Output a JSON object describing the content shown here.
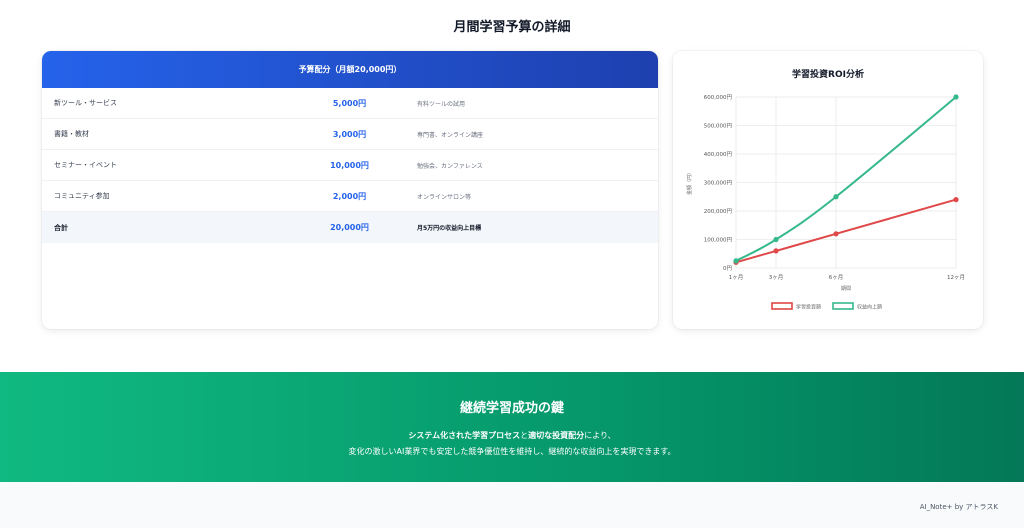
{
  "page": {
    "title": "月間学習予算の詳細"
  },
  "budget": {
    "header": "予算配分（月額20,000円）",
    "rows": [
      {
        "name": "新ツール・サービス",
        "amount": "5,000円",
        "note": "有料ツールの試用"
      },
      {
        "name": "書籍・教材",
        "amount": "3,000円",
        "note": "専門書、オンライン講座"
      },
      {
        "name": "セミナー・イベント",
        "amount": "10,000円",
        "note": "勉強会、カンファレンス"
      },
      {
        "name": "コミュニティ参加",
        "amount": "2,000円",
        "note": "オンラインサロン等"
      }
    ],
    "total": {
      "name": "合計",
      "amount": "20,000円",
      "note": "月5万円の収益向上目標"
    }
  },
  "roi_chart": {
    "title": "学習投資ROI分析"
  },
  "chart_data": {
    "type": "line",
    "categories": [
      "1ヶ月",
      "3ヶ月",
      "6ヶ月",
      "12ヶ月"
    ],
    "x_positions_months": [
      1,
      3,
      6,
      12
    ],
    "series": [
      {
        "name": "学習投資額",
        "color": "#e04848",
        "values": [
          20000,
          60000,
          120000,
          240000
        ]
      },
      {
        "name": "収益向上額",
        "color": "#35b98a",
        "values": [
          25000,
          100000,
          250000,
          600000
        ]
      }
    ],
    "xlabel": "期間",
    "ylabel": "金額（円）",
    "ylim": [
      0,
      600000
    ],
    "yticks": [
      "0円",
      "100,000円",
      "200,000円",
      "300,000円",
      "400,000円",
      "500,000円",
      "600,000円"
    ],
    "grid": true,
    "legend": "bottom"
  },
  "banner": {
    "title": "継続学習成功の鍵",
    "line1_strong1": "システム化された学習プロセス",
    "line1_mid": "と",
    "line1_strong2": "適切な投資配分",
    "line1_end": "により、",
    "line2": "変化の激しいAI業界でも安定した競争優位性を維持し、継続的な収益向上を実現できます。"
  },
  "footer": {
    "credit": "AI_Note+ by アトラスK"
  }
}
